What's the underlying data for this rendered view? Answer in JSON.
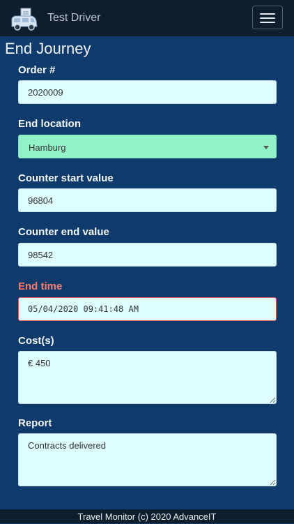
{
  "navbar": {
    "brand_name": "Test Driver",
    "logo_icon": "van-logo-icon",
    "menu_icon": "hamburger-menu-icon"
  },
  "page": {
    "title": "End Journey"
  },
  "form": {
    "order": {
      "label": "Order #",
      "value": "2020009"
    },
    "end_location": {
      "label": "End location",
      "value": "Hamburg"
    },
    "counter_start": {
      "label": "Counter start value",
      "value": "96804"
    },
    "counter_end": {
      "label": "Counter end value",
      "value": "98542"
    },
    "end_time": {
      "label": "End time",
      "value": "05/04/2020 09:41:48 AM"
    },
    "costs": {
      "label": "Cost(s)",
      "value": "€ 450"
    },
    "report": {
      "label": "Report",
      "value": "Contracts delivered"
    }
  },
  "footer": {
    "text": "Travel Monitor (c) 2020 AdvanceIT"
  },
  "colors": {
    "background": "#0e3b6b",
    "navbar": "#0f1e2d",
    "input": "#ddfdfe",
    "valid_select": "#93f3c8",
    "invalid_label": "#ff7b6e"
  }
}
